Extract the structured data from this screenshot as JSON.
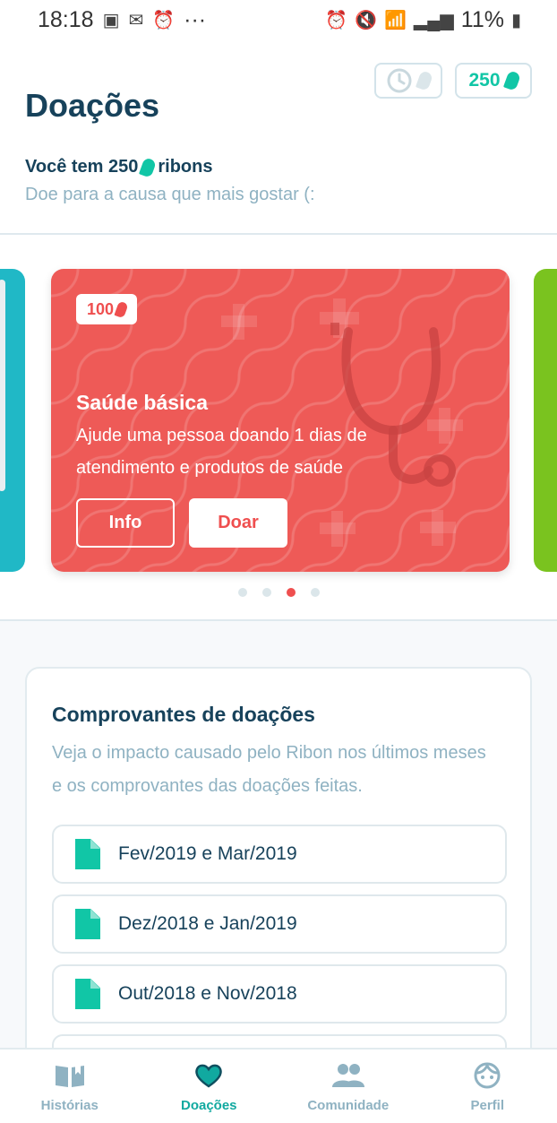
{
  "status_bar": {
    "time": "18:18",
    "dots": "···",
    "battery": "11%"
  },
  "header": {
    "title": "Doações",
    "balance": "250"
  },
  "summary": {
    "prefix": "Você tem 250",
    "suffix": "ribons",
    "subtitle": "Doe para a causa que mais gostar (:"
  },
  "card": {
    "price": "100",
    "title": "Saúde básica",
    "description": "Ajude uma pessoa doando 1 dias de atendimento e produtos de saúde",
    "info_label": "Info",
    "donate_label": "Doar",
    "color": "#ee5a57"
  },
  "carousel": {
    "dots": 4,
    "active_index": 2
  },
  "receipts": {
    "title": "Comprovantes de doações",
    "description": "Veja o impacto causado pelo Ribon nos últimos meses e os comprovantes das doações feitas.",
    "items": [
      {
        "label": "Fev/2019 e Mar/2019"
      },
      {
        "label": "Dez/2018 e Jan/2019"
      },
      {
        "label": "Out/2018 e Nov/2018"
      }
    ]
  },
  "tabs": [
    {
      "label": "Histórias",
      "icon": "book-icon",
      "active": false
    },
    {
      "label": "Doações",
      "icon": "heart-icon",
      "active": true
    },
    {
      "label": "Comunidade",
      "icon": "people-icon",
      "active": false
    },
    {
      "label": "Perfil",
      "icon": "face-icon",
      "active": false
    }
  ],
  "colors": {
    "accent": "#11c6a6",
    "primary_text": "#17425b",
    "muted_text": "#8fb2c2",
    "danger": "#ef4f4f"
  }
}
